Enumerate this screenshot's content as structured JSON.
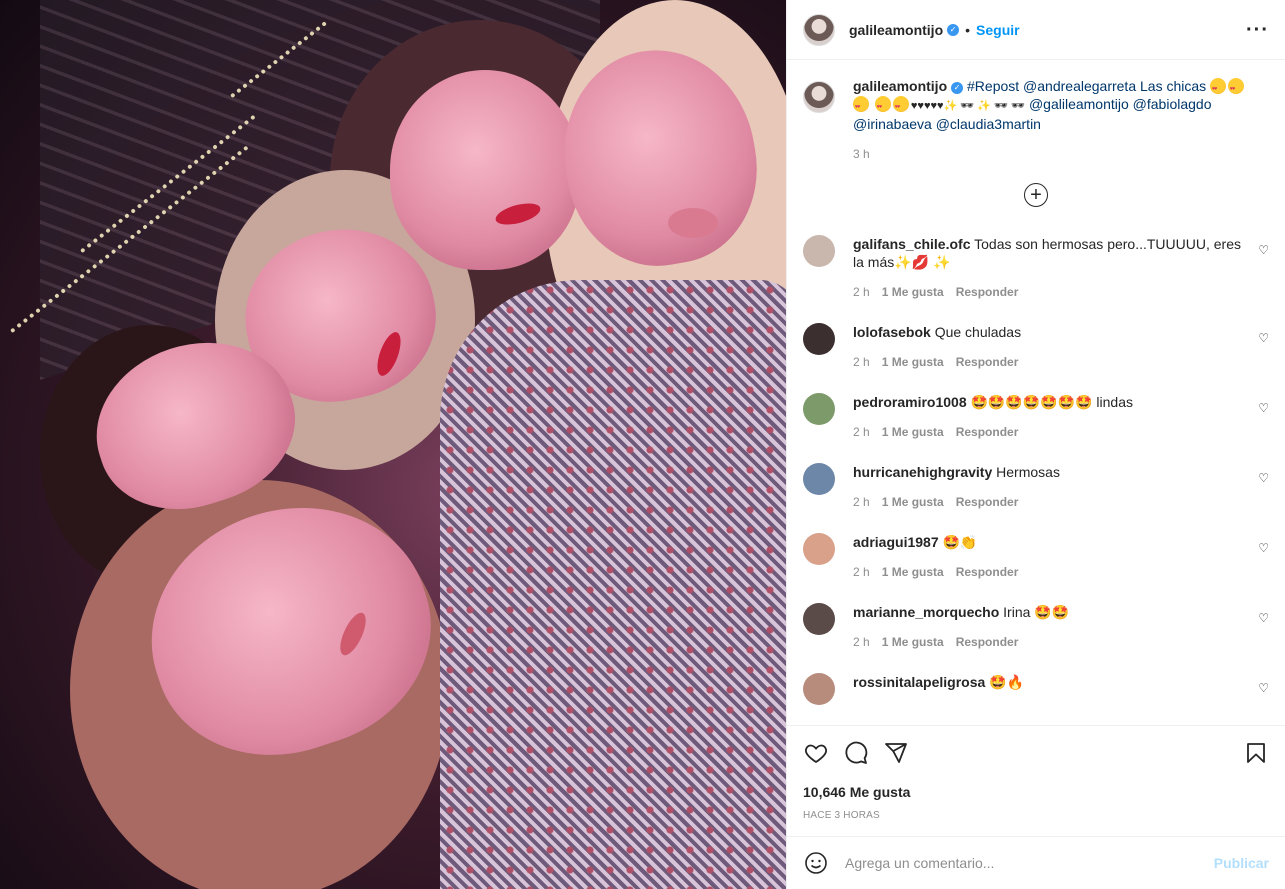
{
  "post": {
    "username": "galileamontijo",
    "verified_icon": "verified-badge-icon",
    "follow_label": "Seguir",
    "more_icon": "more-options-icon",
    "image_alt": "Selfie de cinco mujeres"
  },
  "caption": {
    "username": "galileamontijo",
    "text_before": "#Repost @andrealegarreta Las chicas",
    "text_mid": "♥♥♥♥♥✨ 🕶 ✨ 🕶 🕶",
    "mentions": "@galileamontijo @fabiolagdo @irinabaeva @claudia3martin",
    "time": "3 h"
  },
  "load_more_icon": "add-circle-icon",
  "comments": [
    {
      "username": "galifans_chile.ofc",
      "text": "Todas son hermosas pero...TUUUUU, eres la más✨💋 ✨",
      "time": "2 h",
      "likes": "1 Me gusta",
      "reply": "Responder",
      "avatar_color": "#c9b7ad"
    },
    {
      "username": "lolofasebok",
      "text": "Que chuladas",
      "time": "2 h",
      "likes": "1 Me gusta",
      "reply": "Responder",
      "avatar_color": "#3b2f2f"
    },
    {
      "username": "pedroramiro1008",
      "text": "🤩🤩🤩🤩🤩🤩🤩 lindas",
      "time": "2 h",
      "likes": "1 Me gusta",
      "reply": "Responder",
      "avatar_color": "#7c9a6a"
    },
    {
      "username": "hurricanehighgravity",
      "text": "Hermosas",
      "time": "2 h",
      "likes": "1 Me gusta",
      "reply": "Responder",
      "avatar_color": "#6d87a8"
    },
    {
      "username": "adriagui1987",
      "text": "🤩👏",
      "time": "2 h",
      "likes": "1 Me gusta",
      "reply": "Responder",
      "avatar_color": "#d9a08a"
    },
    {
      "username": "marianne_morquecho",
      "text": "Irina 🤩🤩",
      "time": "2 h",
      "likes": "1 Me gusta",
      "reply": "Responder",
      "avatar_color": "#5a4a48"
    },
    {
      "username": "rossinitalapeligrosa",
      "text": "🤩🔥",
      "time": "",
      "likes": "",
      "reply": "",
      "avatar_color": "#b88c7c"
    }
  ],
  "actions": {
    "likes": "10,646 Me gusta",
    "time_ago": "HACE 3 HORAS",
    "like_icon": "heart-icon",
    "comment_icon": "comment-icon",
    "share_icon": "share-icon",
    "save_icon": "bookmark-icon"
  },
  "add_comment": {
    "placeholder": "Agrega un comentario...",
    "post_label": "Publicar",
    "emoji_icon": "emoji-icon"
  },
  "colors": {
    "accent": "#0095f6",
    "link": "#00376b",
    "muted": "#8e8e8e",
    "post_disabled": "#b2dffc"
  }
}
